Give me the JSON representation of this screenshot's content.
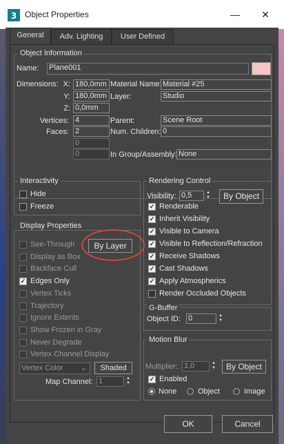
{
  "window": {
    "title": "Object Properties",
    "minimize": "—",
    "close": "✕"
  },
  "tabs": [
    {
      "label": "General",
      "active": true
    },
    {
      "label": "Adv. Lighting",
      "active": false
    },
    {
      "label": "User Defined",
      "active": false
    }
  ],
  "object_info": {
    "group_label": "Object Information",
    "name_label": "Name:",
    "name_value": "Plane001",
    "color_swatch": "#f5c6c6",
    "dimensions_label": "Dimensions:",
    "x_label": "X:",
    "x_value": "180,0mm",
    "y_label": "Y:",
    "y_value": "180,0mm",
    "z_label": "Z:",
    "z_value": "0,0mm",
    "material_name_label": "Material Name:",
    "material_name_value": "Material #25",
    "layer_label": "Layer:",
    "layer_value": "Studio",
    "vertices_label": "Vertices:",
    "vertices_value": "4",
    "faces_label": "Faces:",
    "faces_value": "2",
    "blank1_value": "0",
    "blank2_value": "0",
    "parent_label": "Parent:",
    "parent_value": "Scene Root",
    "num_children_label": "Num. Children:",
    "num_children_value": "0",
    "group_assembly_label": "In Group/Assembly:",
    "group_assembly_value": "None"
  },
  "interactivity": {
    "group_label": "Interactivity",
    "hide_label": "Hide",
    "freeze_label": "Freeze"
  },
  "display_properties": {
    "group_label": "Display Properties",
    "by_layer_label": "By Layer",
    "items": [
      {
        "label": "See-Through",
        "checked": false
      },
      {
        "label": "Display as Box",
        "checked": false
      },
      {
        "label": "Backface Cull",
        "checked": false
      },
      {
        "label": "Edges Only",
        "checked": true
      },
      {
        "label": "Vertex Ticks",
        "checked": false
      },
      {
        "label": "Trajectory",
        "checked": false
      },
      {
        "label": "Ignore Extents",
        "checked": false
      },
      {
        "label": "Show Frozen in Gray",
        "checked": false
      },
      {
        "label": "Never Degrade",
        "checked": false
      },
      {
        "label": "Vertex Channel Display",
        "checked": false
      }
    ],
    "vertex_color_value": "Vertex Color",
    "shaded_label": "Shaded",
    "map_channel_label": "Map Channel:",
    "map_channel_value": "1"
  },
  "rendering_control": {
    "group_label": "Rendering Control",
    "visibility_label": "Visibility:",
    "visibility_value": "0,5",
    "by_object_label": "By Object",
    "items": [
      {
        "label": "Renderable",
        "checked": true
      },
      {
        "label": "Inherit Visibility",
        "checked": true
      },
      {
        "label": "Visible to Camera",
        "checked": true
      },
      {
        "label": "Visible to Reflection/Refraction",
        "checked": true
      },
      {
        "label": "Receive Shadows",
        "checked": true
      },
      {
        "label": "Cast Shadows",
        "checked": true
      },
      {
        "label": "Apply Atmospherics",
        "checked": true
      },
      {
        "label": "Render Occluded Objects",
        "checked": false
      }
    ]
  },
  "gbuffer": {
    "group_label": "G-Buffer",
    "object_id_label": "Object ID:",
    "object_id_value": "0"
  },
  "motion_blur": {
    "group_label": "Motion Blur",
    "multiplier_label": "Multiplier:",
    "multiplier_value": "1,0",
    "by_object_label": "By Object",
    "enabled_label": "Enabled",
    "none_label": "None",
    "object_label": "Object",
    "image_label": "Image"
  },
  "footer": {
    "ok_label": "OK",
    "cancel_label": "Cancel"
  },
  "annotation": {
    "color": "#d9433a"
  }
}
